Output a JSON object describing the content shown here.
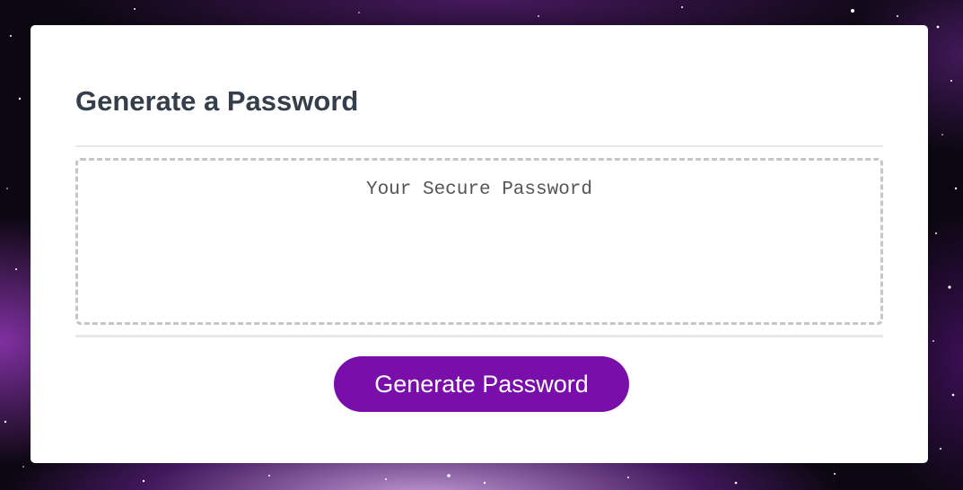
{
  "card": {
    "title": "Generate a Password"
  },
  "password_field": {
    "placeholder": "Your Secure Password",
    "value": ""
  },
  "generate_button": {
    "label": "Generate Password"
  },
  "colors": {
    "accent": "#7a0eab",
    "title_text": "#343f4b",
    "card_background": "#ffffff",
    "divider": "#e8e8e8",
    "dashed_border": "#c5c5ca"
  },
  "background": {
    "icon": "galaxy-starfield-background"
  }
}
